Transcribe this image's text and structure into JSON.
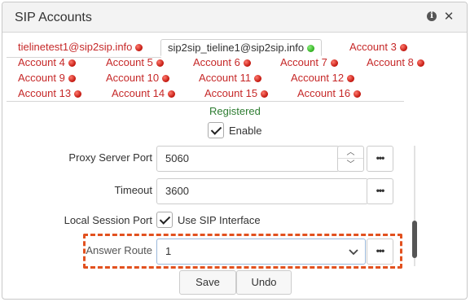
{
  "dialog": {
    "title": "SIP Accounts"
  },
  "tabs": [
    {
      "label": "tielinetest1@sip2sip.info",
      "status": "red",
      "active": false
    },
    {
      "label": "sip2sip_tieline1@sip2sip.info",
      "status": "green",
      "active": true
    },
    {
      "label": "Account 3",
      "status": "red",
      "active": false
    },
    {
      "label": "Account 4",
      "status": "red",
      "active": false
    },
    {
      "label": "Account 5",
      "status": "red",
      "active": false
    },
    {
      "label": "Account 6",
      "status": "red",
      "active": false
    },
    {
      "label": "Account 7",
      "status": "red",
      "active": false
    },
    {
      "label": "Account 8",
      "status": "red",
      "active": false
    },
    {
      "label": "Account 9",
      "status": "red",
      "active": false
    },
    {
      "label": "Account 10",
      "status": "red",
      "active": false
    },
    {
      "label": "Account 11",
      "status": "red",
      "active": false
    },
    {
      "label": "Account 12",
      "status": "red",
      "active": false
    },
    {
      "label": "Account 13",
      "status": "red",
      "active": false
    },
    {
      "label": "Account 14",
      "status": "red",
      "active": false
    },
    {
      "label": "Account 15",
      "status": "red",
      "active": false
    },
    {
      "label": "Account 16",
      "status": "red",
      "active": false
    }
  ],
  "form": {
    "status_text": "Registered",
    "enable": {
      "label": "Enable",
      "checked": true
    },
    "proxy_server_port": {
      "label": "Proxy Server Port",
      "value": "5060"
    },
    "timeout": {
      "label": "Timeout",
      "value": "3600"
    },
    "local_session_port": {
      "label": "Local Session Port",
      "checkbox_label": "Use SIP Interface",
      "checked": true
    },
    "answer_route": {
      "label": "Answer Route",
      "value": "1"
    },
    "more_label": "•••"
  },
  "buttons": {
    "save": "Save",
    "undo": "Undo"
  },
  "colors": {
    "error": "#c62828",
    "ok": "#2e7d32",
    "highlight": "#e2511f"
  }
}
